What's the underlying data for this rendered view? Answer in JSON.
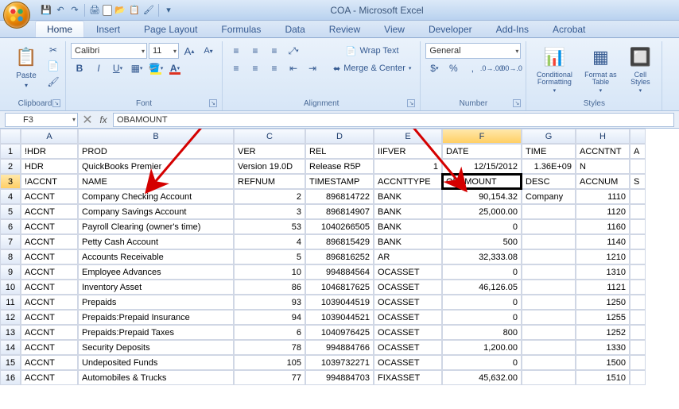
{
  "window": {
    "title": "COA - Microsoft Excel"
  },
  "qat": {
    "items": [
      "save",
      "undo",
      "redo",
      "sep",
      "quickprint",
      "box",
      "box2",
      "paste-opts",
      "brush",
      "sep",
      "more"
    ]
  },
  "tabs": [
    "Home",
    "Insert",
    "Page Layout",
    "Formulas",
    "Data",
    "Review",
    "View",
    "Developer",
    "Add-Ins",
    "Acrobat"
  ],
  "active_tab": 0,
  "ribbon": {
    "clipboard": {
      "title": "Clipboard",
      "paste": "Paste"
    },
    "font": {
      "title": "Font",
      "name": "Calibri",
      "size": "11"
    },
    "alignment": {
      "title": "Alignment",
      "wrap": "Wrap Text",
      "merge": "Merge & Center"
    },
    "number": {
      "title": "Number",
      "format": "General"
    },
    "styles": {
      "title": "Styles",
      "cond": "Conditional Formatting",
      "table": "Format as Table",
      "cell": "Cell Styles"
    }
  },
  "namebox": "F3",
  "formula": "OBAMOUNT",
  "columns": [
    "A",
    "B",
    "C",
    "D",
    "E",
    "F",
    "G",
    "H"
  ],
  "col_classes": [
    "cA",
    "cB",
    "cC",
    "cD",
    "cE",
    "cF",
    "cG",
    "cH"
  ],
  "selected_col": 5,
  "selected_row": 3,
  "rows": [
    {
      "n": 1,
      "c": [
        "!HDR",
        "PROD",
        "VER",
        "REL",
        "IIFVER",
        "DATE",
        "TIME",
        "ACCNTNT"
      ],
      "align": [
        "l",
        "l",
        "l",
        "l",
        "l",
        "l",
        "l",
        "l"
      ]
    },
    {
      "n": 2,
      "c": [
        "HDR",
        "QuickBooks Premier",
        "Version 19.0D",
        "Release R5P",
        "1",
        "12/15/2012",
        "1.36E+09",
        "N"
      ],
      "align": [
        "l",
        "l",
        "l",
        "l",
        "r",
        "r",
        "r",
        "l"
      ]
    },
    {
      "n": 3,
      "c": [
        "!ACCNT",
        "NAME",
        "REFNUM",
        "TIMESTAMP",
        "ACCNTTYPE",
        "OBAMOUNT",
        "DESC",
        "ACCNUM"
      ],
      "align": [
        "l",
        "l",
        "l",
        "l",
        "l",
        "l",
        "l",
        "l"
      ]
    },
    {
      "n": 4,
      "c": [
        "ACCNT",
        "Company Checking Account",
        "2",
        "896814722",
        "BANK",
        "90,154.32",
        "Company",
        "1110"
      ],
      "align": [
        "l",
        "l",
        "r",
        "r",
        "l",
        "r",
        "l",
        "r"
      ]
    },
    {
      "n": 5,
      "c": [
        "ACCNT",
        "Company Savings Account",
        "3",
        "896814907",
        "BANK",
        "25,000.00",
        "",
        "1120"
      ],
      "align": [
        "l",
        "l",
        "r",
        "r",
        "l",
        "r",
        "l",
        "r"
      ]
    },
    {
      "n": 6,
      "c": [
        "ACCNT",
        "Payroll Clearing (owner's time)",
        "53",
        "1040266505",
        "BANK",
        "0",
        "",
        "1160"
      ],
      "align": [
        "l",
        "l",
        "r",
        "r",
        "l",
        "r",
        "l",
        "r"
      ]
    },
    {
      "n": 7,
      "c": [
        "ACCNT",
        "Petty Cash Account",
        "4",
        "896815429",
        "BANK",
        "500",
        "",
        "1140"
      ],
      "align": [
        "l",
        "l",
        "r",
        "r",
        "l",
        "r",
        "l",
        "r"
      ]
    },
    {
      "n": 8,
      "c": [
        "ACCNT",
        "Accounts Receivable",
        "5",
        "896816252",
        "AR",
        "32,333.08",
        "",
        "1210"
      ],
      "align": [
        "l",
        "l",
        "r",
        "r",
        "l",
        "r",
        "l",
        "r"
      ]
    },
    {
      "n": 9,
      "c": [
        "ACCNT",
        "Employee Advances",
        "10",
        "994884564",
        "OCASSET",
        "0",
        "",
        "1310"
      ],
      "align": [
        "l",
        "l",
        "r",
        "r",
        "l",
        "r",
        "l",
        "r"
      ]
    },
    {
      "n": 10,
      "c": [
        "ACCNT",
        "Inventory Asset",
        "86",
        "1046817625",
        "OCASSET",
        "46,126.05",
        "",
        "1121"
      ],
      "align": [
        "l",
        "l",
        "r",
        "r",
        "l",
        "r",
        "l",
        "r"
      ]
    },
    {
      "n": 11,
      "c": [
        "ACCNT",
        "Prepaids",
        "93",
        "1039044519",
        "OCASSET",
        "0",
        "",
        "1250"
      ],
      "align": [
        "l",
        "l",
        "r",
        "r",
        "l",
        "r",
        "l",
        "r"
      ]
    },
    {
      "n": 12,
      "c": [
        "ACCNT",
        "Prepaids:Prepaid Insurance",
        "94",
        "1039044521",
        "OCASSET",
        "0",
        "",
        "1255"
      ],
      "align": [
        "l",
        "l",
        "r",
        "r",
        "l",
        "r",
        "l",
        "r"
      ]
    },
    {
      "n": 13,
      "c": [
        "ACCNT",
        "Prepaids:Prepaid Taxes",
        "6",
        "1040976425",
        "OCASSET",
        "800",
        "",
        "1252"
      ],
      "align": [
        "l",
        "l",
        "r",
        "r",
        "l",
        "r",
        "l",
        "r"
      ]
    },
    {
      "n": 14,
      "c": [
        "ACCNT",
        "Security Deposits",
        "78",
        "994884766",
        "OCASSET",
        "1,200.00",
        "",
        "1330"
      ],
      "align": [
        "l",
        "l",
        "r",
        "r",
        "l",
        "r",
        "l",
        "r"
      ]
    },
    {
      "n": 15,
      "c": [
        "ACCNT",
        "Undeposited Funds",
        "105",
        "1039732271",
        "OCASSET",
        "0",
        "",
        "1500"
      ],
      "align": [
        "l",
        "l",
        "r",
        "r",
        "l",
        "r",
        "l",
        "r"
      ]
    },
    {
      "n": 16,
      "c": [
        "ACCNT",
        "Automobiles & Trucks",
        "77",
        "994884703",
        "FIXASSET",
        "45,632.00",
        "",
        "1510"
      ],
      "align": [
        "l",
        "l",
        "r",
        "r",
        "l",
        "r",
        "l",
        "r"
      ]
    }
  ]
}
